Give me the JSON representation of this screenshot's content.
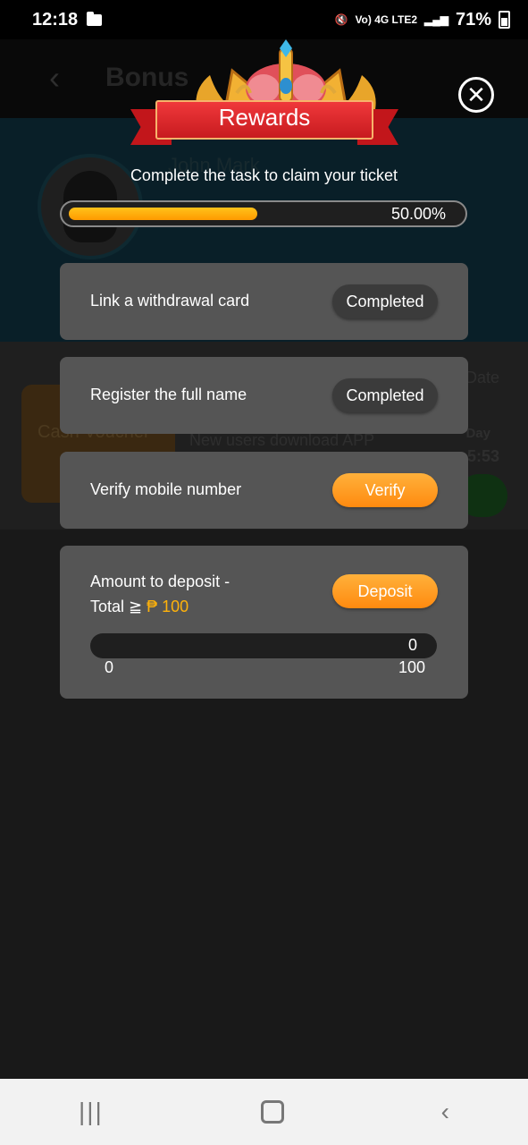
{
  "status": {
    "time": "12:18",
    "network": "Vo) 4G LTE2",
    "battery": "71%"
  },
  "background": {
    "title": "Bonus",
    "user_name": "John Mark",
    "voucher_text": "Cash Voucher",
    "task_text": "New users download APP",
    "date_label": "Date",
    "day_label": "Day",
    "timer": "5:53"
  },
  "modal": {
    "title": "Rewards",
    "subtitle": "Complete the task to claim your ticket",
    "progress": {
      "value": 0.5,
      "label": "50.00%"
    },
    "tasks": [
      {
        "label": "Link a withdrawal card",
        "button": "Completed",
        "state": "completed"
      },
      {
        "label": "Register the full name",
        "button": "Completed",
        "state": "completed"
      },
      {
        "label": "Verify mobile number",
        "button": "Verify",
        "state": "action"
      }
    ],
    "deposit": {
      "label_line1": "Amount to deposit -",
      "label_prefix": "Total ≧",
      "currency": "₱",
      "amount": "100",
      "button": "Deposit",
      "current": "0",
      "min": "0",
      "max": "100",
      "fraction": 0
    }
  },
  "colors": {
    "accent": "#ff9a00",
    "ribbon": "#d41f24",
    "card": "#555555"
  },
  "nav": {
    "recent": "|||",
    "home": "home",
    "back": "‹"
  }
}
